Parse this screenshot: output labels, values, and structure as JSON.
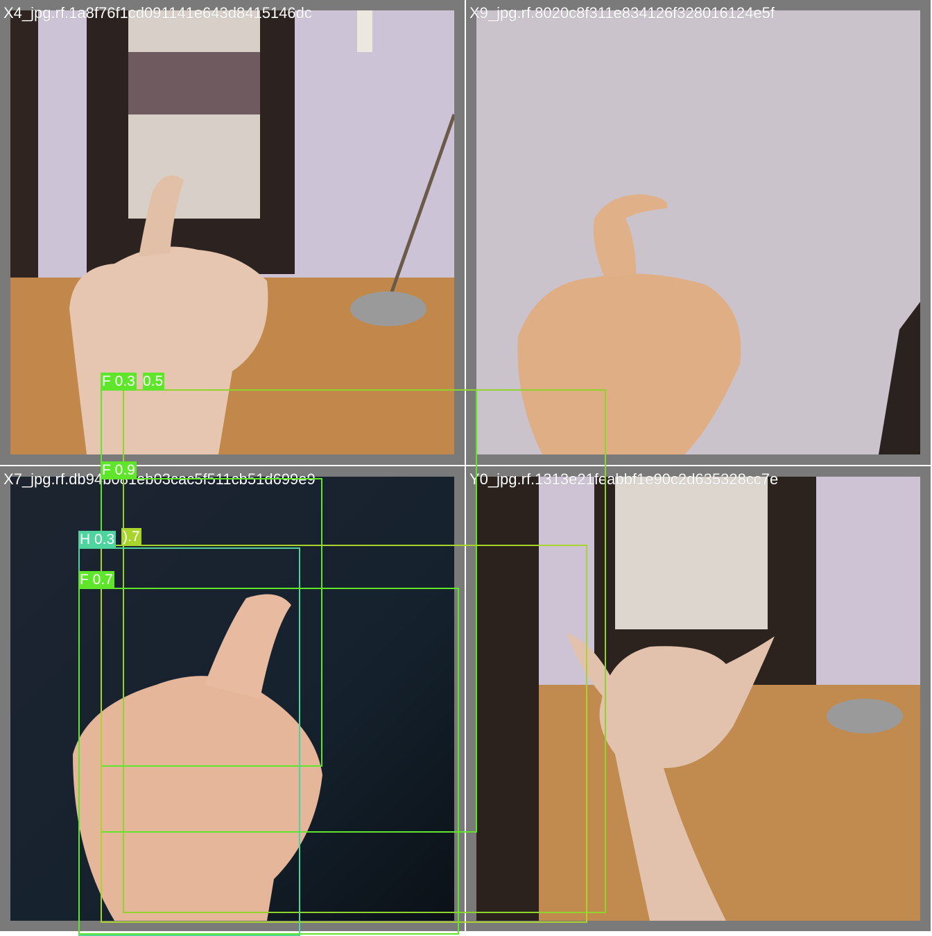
{
  "tiles": [
    {
      "filename": "X4_jpg.rf.1a8f76f1cd091141e643d8415146dc"
    },
    {
      "filename": "X9_jpg.rf.8020c8f311e834126f328016124e5f"
    },
    {
      "filename": "X7_jpg.rf.db94b081eb03cac5f511cb51d699e9"
    },
    {
      "filename": "Y0_jpg.rf.1313e21feabbf1e90c2d635328cc7e"
    }
  ],
  "detections": [
    {
      "label": "F 0.3",
      "color": "#5fe62b"
    },
    {
      "label": "0.5",
      "color": "#8fd42b"
    },
    {
      "label": "F 0.9",
      "color": "#5fe62b"
    },
    {
      "label": ").7",
      "color": "#a8d42b"
    },
    {
      "label": "H 0.3",
      "color": "#4fd4a0"
    },
    {
      "label": "F 0.7",
      "color": "#5fe62b"
    }
  ]
}
